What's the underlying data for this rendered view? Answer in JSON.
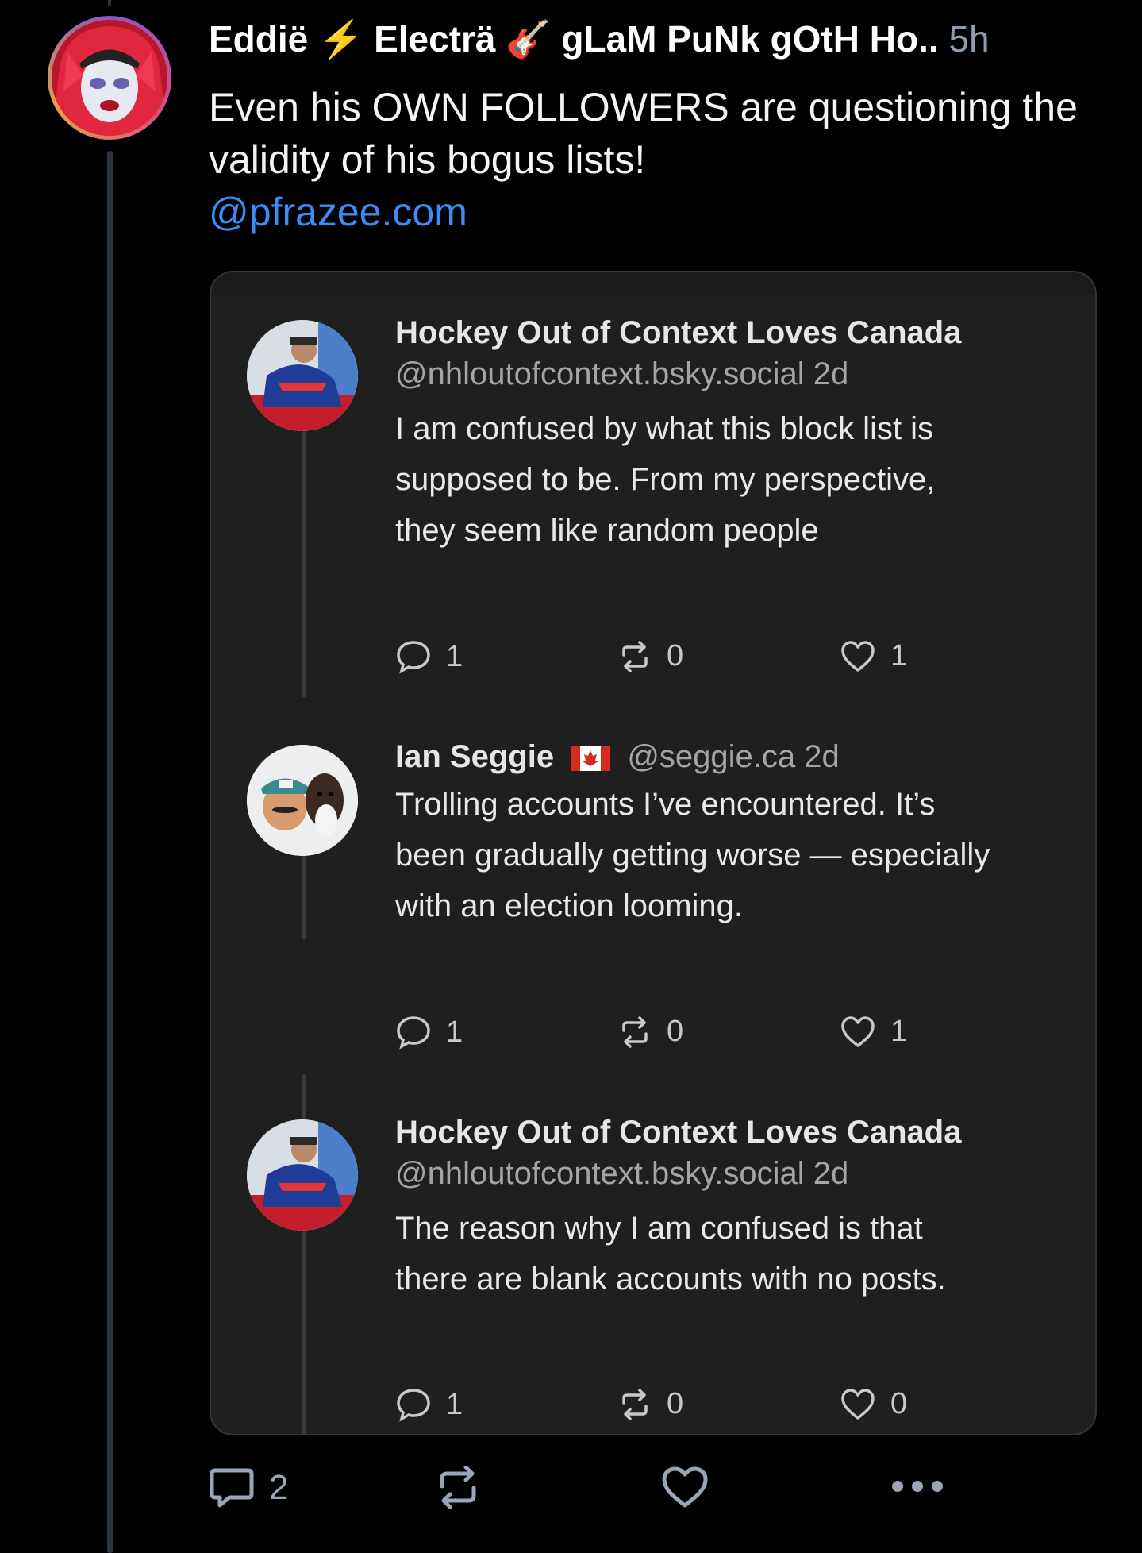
{
  "post": {
    "author_name": "Eddiё ⚡ Electrä 🎸 gLaM PuNk gOtH Ho..",
    "time": "5h",
    "text": "Even his OWN FOLLOWERS are questioning the validity of his bogus lists!",
    "mention": "@pfrazee.com",
    "actions": {
      "reply_count": "2"
    }
  },
  "quote": {
    "comments": [
      {
        "name": "Hockey Out of Context Loves Canada",
        "handle": "@nhloutofcontext.bsky.social 2d",
        "lines": [
          "I am confused by what this block list is",
          "supposed to be. From my perspective,",
          "they seem like random people"
        ],
        "replies": "1",
        "reposts": "0",
        "likes": "1"
      },
      {
        "name": "Ian Seggie",
        "handle": "@seggie.ca 2d",
        "lines": [
          "Trolling accounts I’ve encountered.  It’s",
          "been gradually getting worse — especially",
          "with an election looming."
        ],
        "replies": "1",
        "reposts": "0",
        "likes": "1"
      },
      {
        "name": "Hockey Out of Context Loves Canada",
        "handle": "@nhloutofcontext.bsky.social 2d",
        "lines": [
          "The reason why I am confused is that",
          "there are blank accounts with no posts."
        ],
        "replies": "1",
        "reposts": "0",
        "likes": "0"
      }
    ]
  },
  "icons": [
    "speech-bubble-icon",
    "repost-icon",
    "heart-icon",
    "more-icon",
    "lightning-icon",
    "guitar-icon",
    "canada-flag-icon"
  ],
  "colors": {
    "background": "#000000",
    "mention": "#3b8cf5",
    "card": "#1f1f1f",
    "muted": "#8f9bb0"
  }
}
